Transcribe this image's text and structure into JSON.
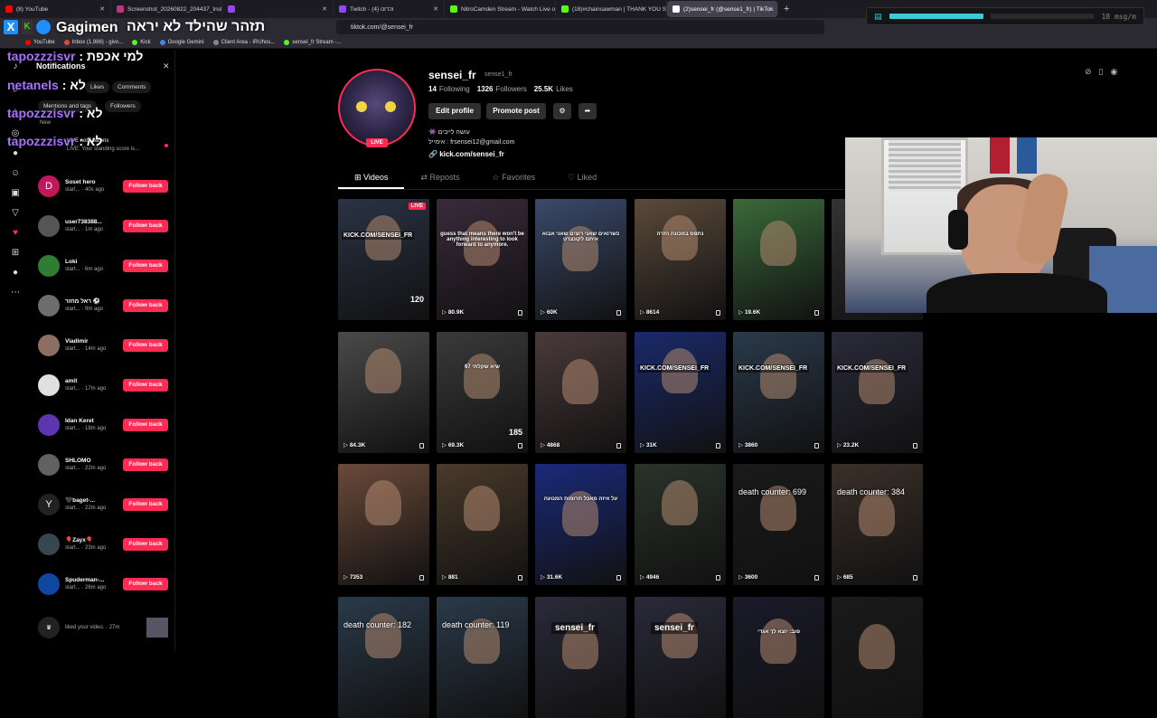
{
  "browser": {
    "tabs": [
      {
        "label": "(8) YouTube",
        "color": "#ff0000"
      },
      {
        "label": "Screenshot_20260822_204437_Insta...",
        "color": "#c13584"
      },
      {
        "label": "",
        "color": "#9146ff"
      },
      {
        "label": "Twitch - (4) וכרונו",
        "color": "#9146ff"
      },
      {
        "label": "NitroCamden Stream - Watch Live on",
        "color": "#53fc18"
      },
      {
        "label": "(18)#chainsawman | THANK YOU SO",
        "color": "#53fc18"
      },
      {
        "label": "(2)sensei_fr (@sense1_fr) | TikTok",
        "color": "#ffffff",
        "active": true
      }
    ],
    "url": "tiktok.com/@sensei_fr",
    "bookmarks": [
      {
        "label": "YouTube",
        "color": "#ff0000"
      },
      {
        "label": "Inbox (1,986) - givo...",
        "color": "#ea4335"
      },
      {
        "label": "Kick",
        "color": "#53fc18"
      },
      {
        "label": "Google Gemini",
        "color": "#4285f4"
      },
      {
        "label": "Client Area - IRUhos...",
        "color": "#888888"
      },
      {
        "label": "sensei_fr Stream -...",
        "color": "#53fc18"
      }
    ]
  },
  "overlay": {
    "title": "Gagimen",
    "banner": "תזהר שהילד לא יראה",
    "chat_rate": "18 msg/m",
    "chat_lines": [
      {
        "user": "tapozzzisvr",
        "text": ": למי אכפת"
      },
      {
        "user": "netanels",
        "text": ": לא"
      },
      {
        "user": "tapozzzisvr",
        "text": ": לא"
      },
      {
        "user": "tapozzzisvr",
        "text": ": לא"
      }
    ]
  },
  "notifications": {
    "title": "Notifications",
    "tabs": {
      "likes": "Likes",
      "comments": "Comments",
      "mentions": "Mentions and tags",
      "followers": "Followers"
    },
    "new_label": "New",
    "live_title": "LIVE notifications",
    "live_text": "LIVE: Your standing score is...",
    "follow_label": "Follow back",
    "items": [
      {
        "name": "Soset hero",
        "sub": "start... · 40s ago",
        "initial": "D",
        "color": "#c2185b"
      },
      {
        "name": "user738388...",
        "sub": "start... · 1m ago",
        "initial": "",
        "color": "#555555"
      },
      {
        "name": "Loki",
        "sub": "start... · 6m ago",
        "initial": "",
        "color": "#2e7d32"
      },
      {
        "name": "ראל מחזר ⚽",
        "sub": "start... · 9m ago",
        "initial": "",
        "color": "#6d6d6d"
      },
      {
        "name": "Viadimir",
        "sub": "start... · 14m ago",
        "initial": "",
        "color": "#8d6e63"
      },
      {
        "name": "amit",
        "sub": "start... · 17m ago",
        "initial": "",
        "color": "#e0e0e0"
      },
      {
        "name": "Idan Keret",
        "sub": "start... · 18m ago",
        "initial": "",
        "color": "#5e35b1"
      },
      {
        "name": "SHLOMO",
        "sub": "start... · 22m ago",
        "initial": "",
        "color": "#616161"
      },
      {
        "name": "🖤baget-...",
        "sub": "start... · 22m ago",
        "initial": "Y",
        "color": "#222222"
      },
      {
        "name": "🎈Zayx🎈",
        "sub": "start... · 23m ago",
        "initial": "",
        "color": "#37474f"
      },
      {
        "name": "Spuderman-...",
        "sub": "start... · 26m ago",
        "initial": "",
        "color": "#0d47a1"
      }
    ],
    "last": {
      "text": "liked your video. · 27m"
    }
  },
  "profile": {
    "username": "sensei_fr",
    "nickname": "sense1_fr",
    "live": "LIVE",
    "following": {
      "count": "14",
      "label": "Following"
    },
    "followers": {
      "count": "1326",
      "label": "Followers"
    },
    "likes": {
      "count": "25.5K",
      "label": "Likes"
    },
    "edit_label": "Edit profile",
    "promote_label": "Promote post",
    "bio_line1": "עושה לייבים 👾",
    "bio_line2": "אימייל : frsensei12@gmail.com",
    "link": "kick.com/sensei_fr",
    "tabs": [
      "Videos",
      "Reposts",
      "Favorites",
      "Liked"
    ]
  },
  "videos": [
    {
      "views": "",
      "bg": "#2a3344",
      "kick": "KICK.COM/SENSEI_FR",
      "live": "LIVE",
      "extra": "120"
    },
    {
      "views": "80.9K",
      "bg": "#3a2a3a",
      "caption": "guess that means there won't be anything interesting to look forward to anymore."
    },
    {
      "views": "60K",
      "bg": "#3a4a6a",
      "caption": "כשרואים שאני רוצים שאני אבוא איתם לקונצרט"
    },
    {
      "views": "8614",
      "bg": "#5a4a3a",
      "caption": "נתפס במכונה הזרה"
    },
    {
      "views": "19.6K",
      "bg": "#3a6a3a"
    },
    {
      "views": "",
      "bg": "#333333"
    },
    {
      "views": "84.3K",
      "bg": "#4a4a4a"
    },
    {
      "views": "69.3K",
      "bg": "#3a3a3a",
      "caption": "שיא שקלתי 67",
      "extra": "185"
    },
    {
      "views": "4868",
      "bg": "#4a3a3a"
    },
    {
      "views": "31K",
      "bg": "#1a2a6a",
      "kick": "KICK.COM/SENSEI_FR"
    },
    {
      "views": "3860",
      "bg": "#2a3a4a",
      "kick": "KICK.COM/SENSEI_FR"
    },
    {
      "views": "23.2K",
      "bg": "#2a2a3a",
      "kick": "KICK.COM/SENSEI_FR"
    },
    {
      "views": "7353",
      "bg": "#6a4a3a"
    },
    {
      "views": "881",
      "bg": "#4a3a2a"
    },
    {
      "views": "31.6K",
      "bg": "#1a2a7a",
      "caption": "על איזה מאכל תרומות המנועה"
    },
    {
      "views": "4946",
      "bg": "#2a332a"
    },
    {
      "views": "3600",
      "bg": "#1a1a1a",
      "death": "death counter: 699"
    },
    {
      "views": "685",
      "bg": "#3a3028",
      "death": "death counter: 384"
    },
    {
      "views": "",
      "bg": "#2a3a4a",
      "death": "death counter: 182"
    },
    {
      "views": "",
      "bg": "#2a3a4a",
      "death": "death counter: 119"
    },
    {
      "views": "",
      "bg": "#2a2a3a",
      "twitch": "sensei_fr"
    },
    {
      "views": "",
      "bg": "#2a2a3a",
      "twitch": "sensei_fr"
    },
    {
      "views": "",
      "bg": "#1a1a2a",
      "caption": "פוב: יוצא לך אגדי"
    },
    {
      "views": "",
      "bg": "#1a1a1a"
    }
  ]
}
